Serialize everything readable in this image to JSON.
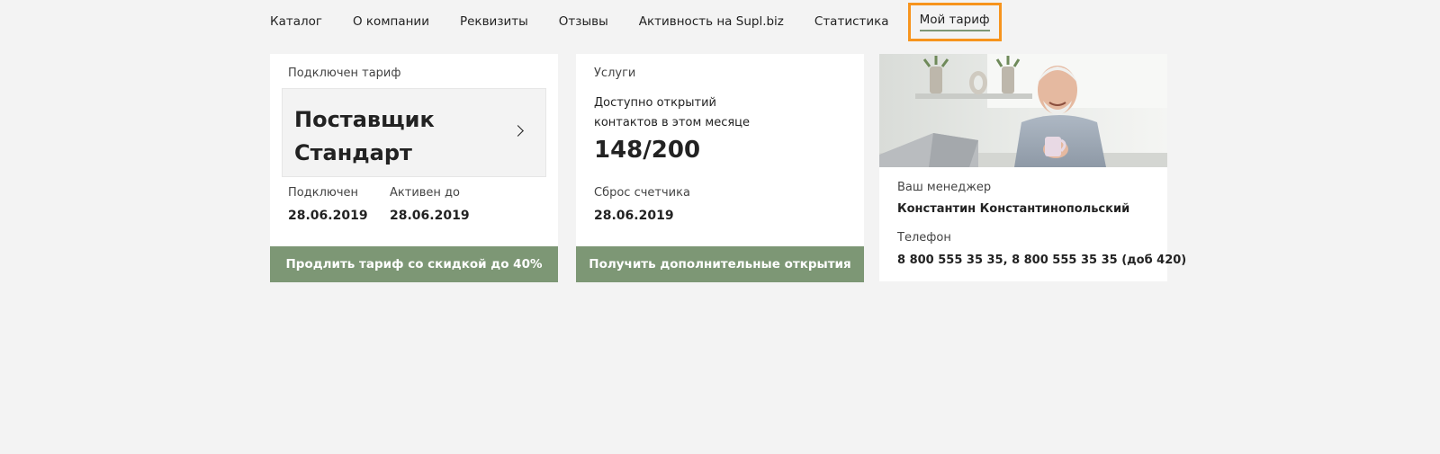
{
  "nav": {
    "items": [
      "Каталог",
      "О компании",
      "Реквизиты",
      "Отзывы",
      "Активность на Supl.biz",
      "Статистика"
    ],
    "active": "Мой тариф"
  },
  "tariff": {
    "heading": "Подключен тариф",
    "name": "Поставщик Стандарт",
    "connected_label": "Подключен",
    "connected_value": "28.06.2019",
    "active_until_label": "Активен до",
    "active_until_value": "28.06.2019",
    "button_label": "Продлить тариф со скидкой до 40%"
  },
  "services": {
    "heading": "Услуги",
    "available_label": "Доступно открытий контактов в этом месяце",
    "count": "148/200",
    "reset_label": "Сброс счетчика",
    "reset_value": "28.06.2019",
    "button_label": "Получить дополнительные открытия"
  },
  "manager": {
    "label": "Ваш менеджер",
    "name": "Константин Константинопольский",
    "phone_label": "Телефон",
    "phone_value": "8 800 555 35 35, 8 800 555 35 35 (доб 420)"
  },
  "colors": {
    "accent": "#7d9775",
    "highlight": "#f7941d",
    "background": "#f3f3f3"
  }
}
